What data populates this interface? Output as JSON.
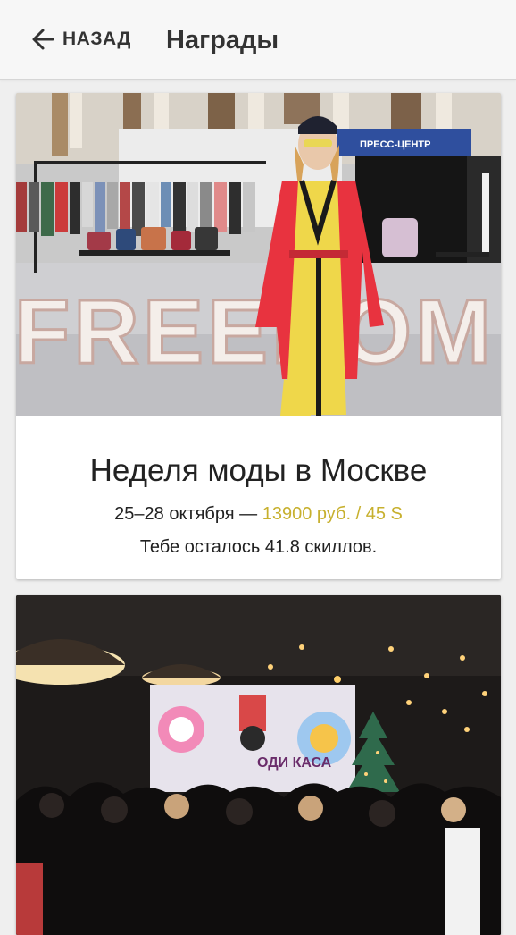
{
  "header": {
    "back_label": "НАЗАД",
    "title": "Награды"
  },
  "rewards": [
    {
      "photo_sign_top": "ПРЕСС-ЦЕНТР",
      "photo_letters": "FREEDOM",
      "title": "Неделя моды в Москве",
      "dates": "25–28 октября — ",
      "price": "13900 руб. / 45 S",
      "remaining": "Тебе осталось 41.8 скиллов."
    },
    {
      "photo_screen_text": "ОДИ КАСА"
    }
  ],
  "colors": {
    "accent_price": "#c7b02e",
    "coat_red": "#e8333f",
    "coat_yellow": "#efd74a"
  }
}
